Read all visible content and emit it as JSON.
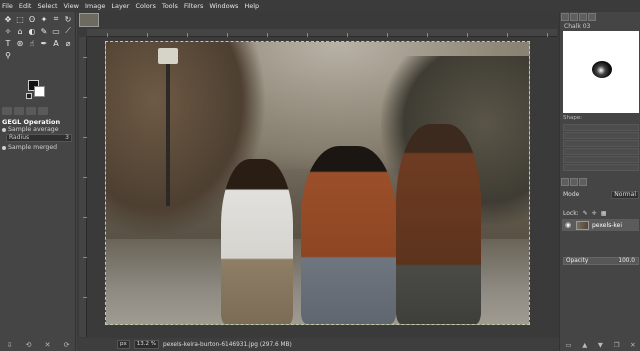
{
  "menu": [
    "File",
    "Edit",
    "Select",
    "View",
    "Image",
    "Layer",
    "Colors",
    "Tools",
    "Filters",
    "Windows",
    "Help"
  ],
  "tool_options": {
    "title": "GEGL Operation",
    "sample_average": "Sample average",
    "radius_label": "Radius",
    "radius_value": "3",
    "sample_merged": "Sample merged"
  },
  "status": {
    "unit": "px",
    "zoom": "13.2 %",
    "filename": "pexels-keira-burton-6146931.jpg (297.6 MB)"
  },
  "brushes": {
    "name": "Chalk 03",
    "shape_label": "Shape:"
  },
  "layers": {
    "mode_label": "Mode",
    "mode_value": "Normal",
    "opacity_label": "Opacity",
    "opacity_value": "100.0",
    "lock_label": "Lock:",
    "layer_name": "pexels-kei"
  }
}
